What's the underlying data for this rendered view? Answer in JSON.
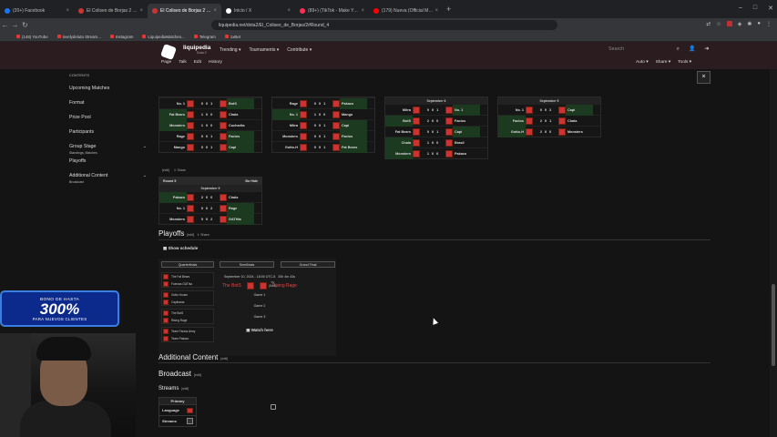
{
  "browser": {
    "tabs": [
      {
        "title": "(20+) Facebook",
        "color": "#1877f2",
        "active": false
      },
      {
        "title": "El Coliseo de Borjas 2 - Liquipedia",
        "color": "#cc3433",
        "active": false
      },
      {
        "title": "El Coliseo de Borjas 2 - Liquipedia",
        "color": "#cc3433",
        "active": true
      },
      {
        "title": "Inicio / X",
        "color": "#ffffff",
        "active": false
      },
      {
        "title": "(89+) (TikTok - Make Your Day",
        "color": "#ff2d55",
        "active": false
      },
      {
        "title": "(179) Nueva (Official Music Video",
        "color": "#ff0000",
        "active": false
      }
    ],
    "new_tab": "+",
    "url": "liquipedia.net/dota2/El_Coliseo_de_Borjas/2#Round_4",
    "bookmarks": [
      "(148) YouTube",
      "lovelydeluta Stream...",
      "Instagram",
      "LiquipediaMatches...",
      "Telegram",
      "1xBet"
    ]
  },
  "site": {
    "brand": "liquipedia",
    "brand_sub": "Dota 2",
    "nav": [
      "Trending ▾",
      "Tournaments ▾",
      "Contribute ▾"
    ],
    "search_placeholder": "Search",
    "subnav": [
      "Page",
      "Talk",
      "Edit",
      "History"
    ],
    "subnav_right": [
      "Auto ▾",
      "Share ▾",
      "Tools ▾"
    ]
  },
  "toc": {
    "heading": "CONTENTS",
    "items": [
      {
        "label": "Upcoming Matches",
        "sub": ""
      },
      {
        "label": "Format",
        "sub": ""
      },
      {
        "label": "Prize Pool",
        "sub": ""
      },
      {
        "label": "Participants",
        "sub": ""
      },
      {
        "label": "Group Stage",
        "sub": "Standings, Matches"
      },
      {
        "label": "Playoffs",
        "sub": ""
      },
      {
        "label": "Additional Content",
        "sub": "Broadcast"
      }
    ]
  },
  "close_button": "×",
  "match_tables": [
    {
      "round": "",
      "bo": "",
      "date": "",
      "rows": [
        [
          "No. 1",
          "0",
          "0",
          "1",
          "BotS",
          1
        ],
        [
          "Fat Bears",
          "1",
          "0",
          "0",
          "Chala",
          0
        ],
        [
          "Monsters",
          "1",
          "0",
          "0",
          "Cucharita",
          0
        ],
        [
          "Rage",
          "0",
          "0",
          "1",
          "Factos",
          1
        ],
        [
          "Mango",
          "0",
          "0",
          "1",
          "Capi",
          1
        ]
      ]
    },
    {
      "round": "",
      "bo": "",
      "date": "",
      "rows": [
        [
          "Rage",
          "0",
          "0",
          "1",
          "Pakazo",
          1
        ],
        [
          "No. 1",
          "1",
          "0",
          "0",
          "Mango",
          0
        ],
        [
          "Mitra",
          "0",
          "0",
          "1",
          "Capi",
          1
        ],
        [
          "Monsters",
          "0",
          "0",
          "1",
          "Factos",
          1
        ],
        [
          "Gotto-H",
          "0",
          "0",
          "1",
          "Fat Bears",
          1
        ]
      ]
    },
    {
      "round": "",
      "bo": "",
      "date": "September 6",
      "rows": [
        [
          "Mitra",
          "0",
          "0",
          "1",
          "No. 1",
          1
        ],
        [
          "BotS",
          "2",
          "0",
          "0",
          "Factos",
          0
        ],
        [
          "Fat Bears",
          "0",
          "0",
          "1",
          "Capi",
          1
        ],
        [
          "Chala",
          "1",
          "0",
          "0",
          "Brasil",
          0
        ],
        [
          "Monsters",
          "1",
          "0",
          "0",
          "Pakazo",
          0
        ]
      ]
    },
    {
      "round": "",
      "bo": "",
      "date": "September 5",
      "rows": [
        [
          "No. 1",
          "0",
          "0",
          "2",
          "Capi",
          1
        ],
        [
          "Factos",
          "2",
          "0",
          "1",
          "Chala",
          0
        ],
        [
          "Gotto-H",
          "2",
          "0",
          "0",
          "Monsters",
          0
        ]
      ]
    },
    {
      "round": "Round 5",
      "bo": "Bo Hide",
      "date": "September 9",
      "rows": [
        [
          "Pakazo",
          "2",
          "0",
          "0",
          "Chala",
          0
        ],
        [
          "No. 1",
          "0",
          "0",
          "2",
          "Rage",
          1
        ],
        [
          "Monsters",
          "0",
          "0",
          "2",
          "GATHia",
          1
        ]
      ]
    }
  ],
  "edit_share": {
    "edit": "[edit]",
    "share": "Share"
  },
  "playoffs": {
    "title": "Playoffs",
    "edit": "[edit]",
    "share": "Share",
    "show_schedule": "Show schedule",
    "rounds": [
      "Quarterfinals",
      "Semifinals",
      "Grand Final"
    ],
    "quarterfinals": [
      [
        "The Fat Bears",
        "Fuerzas GAThia"
      ],
      [
        "Gotto House",
        "Capibaras"
      ],
      [
        "The BotS",
        "Rising Rage"
      ],
      [
        "Team Factos Army",
        "Team Pakazo"
      ]
    ],
    "semifinal": {
      "date": "September 10, 2024 - 18:00 UTC-5",
      "countdown": "20h 4m 43s",
      "team1": "The BotS",
      "team2": "Rising Rage",
      "vs": "vs",
      "format": "(Bo3)",
      "games": [
        "Game 1",
        "Game 2",
        "Game 3"
      ],
      "watch": "Watch here"
    }
  },
  "additional": {
    "title": "Additional Content",
    "edit": "[edit]",
    "broadcast": "Broadcast",
    "broadcast_edit": "[edit]",
    "streams": "Streams",
    "streams_edit": "[edit]",
    "table": {
      "header": "Primary",
      "rows": [
        "Language",
        "Streams"
      ]
    }
  },
  "promo": {
    "line1": "BONO DE HASTA",
    "line2": "300%",
    "line3": "PARA NUEVOS CLIENTES"
  },
  "colors": {
    "accent_red": "#cc3433",
    "win_bg": "#1c3a1f",
    "header_bg": "#2b1d1f"
  }
}
